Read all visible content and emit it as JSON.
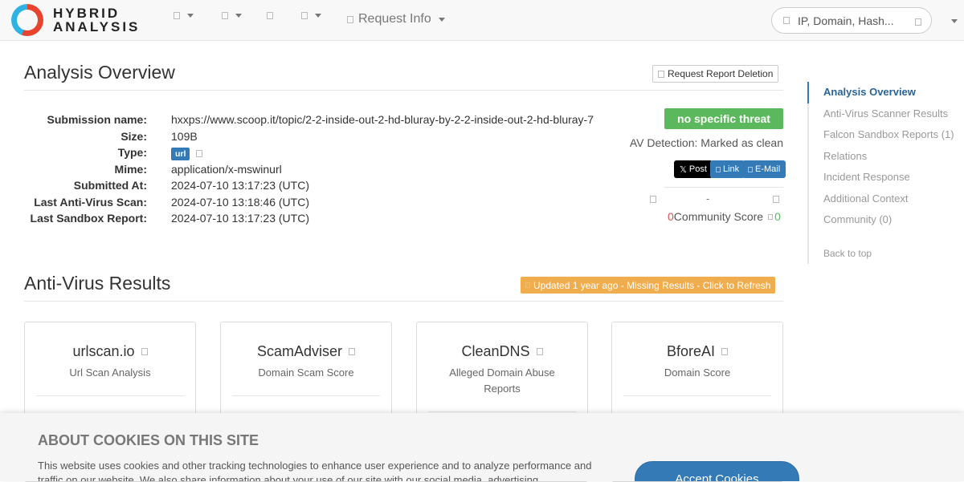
{
  "brand": {
    "name_line1": "HYBRID",
    "name_line2": "ANALYSIS"
  },
  "nav": {
    "request_info": "Request Info",
    "search_placeholder": "IP, Domain, Hash..."
  },
  "overview": {
    "title": "Analysis Overview",
    "request_deletion": "Request Report Deletion",
    "fields": [
      {
        "label": "Submission name:",
        "value": "hxxps://www.scoop.it/topic/2-2-inside-out-2-hd-bluray-by-2-2-inside-out-2-hd-bluray-7"
      },
      {
        "label": "Size:",
        "value": "109B"
      },
      {
        "label": "Type:",
        "value": "url"
      },
      {
        "label": "Mime:",
        "value": "application/x-mswinurl"
      },
      {
        "label": "Submitted At:",
        "value": "2024-07-10 13:17:23 (UTC)"
      },
      {
        "label": "Last Anti-Virus Scan:",
        "value": "2024-07-10 13:18:46 (UTC)"
      },
      {
        "label": "Last Sandbox Report:",
        "value": "2024-07-10 13:17:23 (UTC)"
      }
    ],
    "threat_badge": "no specific threat",
    "threat_color": "#5cb85c",
    "av_detection": "AV Detection: Marked as clean",
    "share": {
      "post": "Post",
      "link": "Link",
      "email": "E-Mail"
    },
    "community": {
      "dash": "-",
      "neg": "0",
      "label": "Community Score",
      "pos": "0"
    }
  },
  "av_results": {
    "title": "Anti-Virus Results",
    "refresh": "Updated 1 year ago - Missing Results - Click to Refresh",
    "cards": [
      {
        "title": "urlscan.io",
        "subtitle": "Url Scan Analysis"
      },
      {
        "title": "ScamAdviser",
        "subtitle": "Domain Scam Score"
      },
      {
        "title": "CleanDNS",
        "subtitle": "Alleged Domain Abuse Reports"
      },
      {
        "title": "BforeAI",
        "subtitle": "Domain Score"
      }
    ]
  },
  "sidenav": {
    "items": [
      "Analysis Overview",
      "Anti-Virus Scanner Results",
      "Falcon Sandbox Reports (1)",
      "Relations",
      "Incident Response",
      "Additional Context",
      "Community (0)"
    ],
    "back_to_top": "Back to top"
  },
  "cookie": {
    "title": "ABOUT COOKIES ON THIS SITE",
    "body": "This website uses cookies and other tracking technologies to enhance user experience and to analyze performance and traffic on our website. We also share information about your use of our site with our social media, advertising",
    "accept": "Accept Cookies"
  }
}
